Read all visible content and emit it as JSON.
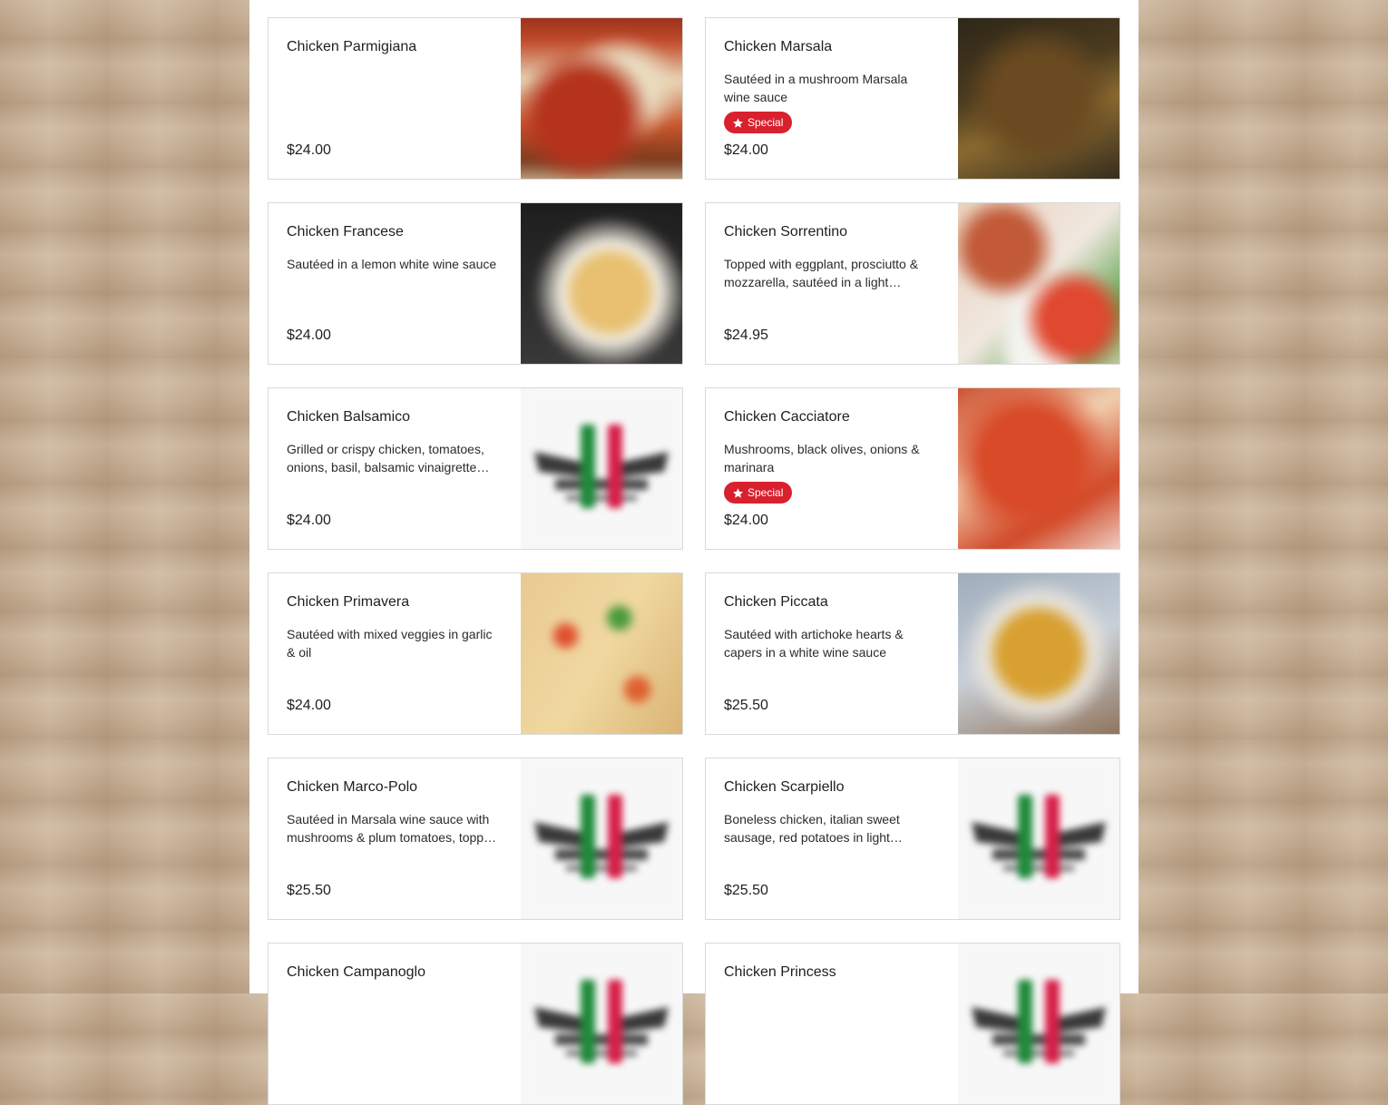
{
  "menu_items": [
    {
      "name": "Chicken Parmigiana",
      "description": "",
      "special": false,
      "special_label": "",
      "price": "$24.00",
      "image": "chicken-parmigiana-photo"
    },
    {
      "name": "Chicken Marsala",
      "description": "Sautéed in a mushroom Marsala wine sauce",
      "special": true,
      "special_label": "Special",
      "price": "$24.00",
      "image": "chicken-marsala-photo"
    },
    {
      "name": "Chicken Francese",
      "description": "Sautéed in a lemon white wine sauce",
      "special": false,
      "special_label": "",
      "price": "$24.00",
      "image": "chicken-francese-photo"
    },
    {
      "name": "Chicken Sorrentino",
      "description": "Topped with eggplant, prosciutto & mozzarella, sautéed in a light brown…",
      "special": false,
      "special_label": "",
      "price": "$24.95",
      "image": "chicken-sorrentino-photo"
    },
    {
      "name": "Chicken Balsamico",
      "description": "Grilled or crispy chicken, tomatoes, onions, basil, balsamic vinaigrette…",
      "special": false,
      "special_label": "",
      "price": "$24.00",
      "image": "restaurant-logo-placeholder"
    },
    {
      "name": "Chicken Cacciatore",
      "description": "Mushrooms, black olives, onions & marinara",
      "special": true,
      "special_label": "Special",
      "price": "$24.00",
      "image": "chicken-cacciatore-photo"
    },
    {
      "name": "Chicken Primavera",
      "description": "Sautéed with mixed veggies in garlic & oil",
      "special": false,
      "special_label": "",
      "price": "$24.00",
      "image": "chicken-primavera-photo"
    },
    {
      "name": "Chicken Piccata",
      "description": "Sautéed with artichoke hearts & capers in a white wine sauce",
      "special": false,
      "special_label": "",
      "price": "$25.50",
      "image": "chicken-piccata-photo"
    },
    {
      "name": "Chicken Marco-Polo",
      "description": "Sautéed in Marsala wine sauce with mushrooms & plum tomatoes, topp…",
      "special": false,
      "special_label": "",
      "price": "$25.50",
      "image": "restaurant-logo-placeholder"
    },
    {
      "name": "Chicken Scarpiello",
      "description": "Boneless chicken, italian sweet sausage, red potatoes in light white…",
      "special": false,
      "special_label": "",
      "price": "$25.50",
      "image": "restaurant-logo-placeholder"
    },
    {
      "name": "Chicken Campanoglo",
      "description": "",
      "special": false,
      "special_label": "",
      "price": "",
      "image": "restaurant-logo-placeholder"
    },
    {
      "name": "Chicken Princess",
      "description": "",
      "special": false,
      "special_label": "",
      "price": "",
      "image": "restaurant-logo-placeholder"
    }
  ],
  "colors": {
    "special_badge": "#d9202e",
    "card_border": "#d9d9d9",
    "background_wood": "#c9b196"
  },
  "icons": {
    "special": "star-icon"
  }
}
